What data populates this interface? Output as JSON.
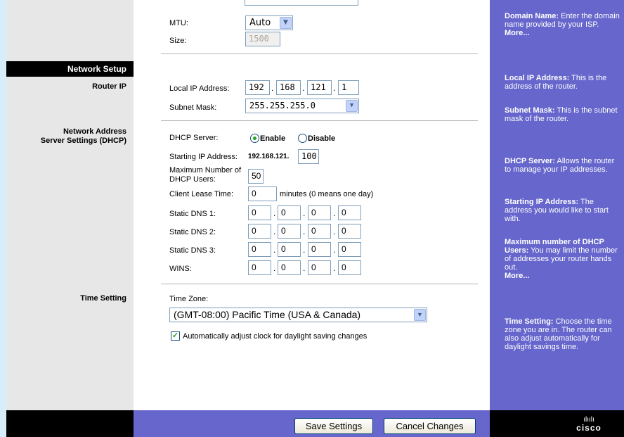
{
  "mtu": {
    "label": "MTU:",
    "value": "Auto",
    "size_label": "Size:",
    "size_value": "1500"
  },
  "sections": {
    "network_setup": "Network Setup",
    "router_ip": "Router IP",
    "dhcp_line1": "Network Address",
    "dhcp_line2": "Server Settings (DHCP)",
    "time_setting": "Time Setting"
  },
  "router_ip": {
    "local_ip_label": "Local IP Address:",
    "octets": [
      "192",
      "168",
      "121",
      "1"
    ],
    "subnet_label": "Subnet Mask:",
    "subnet_value": "255.255.255.0"
  },
  "dhcp": {
    "server_label": "DHCP Server:",
    "enable": "Enable",
    "disable": "Disable",
    "start_label": "Starting IP Address:",
    "start_prefix": "192.168.121.",
    "start_value": "100",
    "max_label_1": "Maximum Number of",
    "max_label_2": "DHCP Users:",
    "max_value": "50",
    "lease_label": "Client Lease Time:",
    "lease_value": "0",
    "lease_suffix": "minutes (0 means one day)",
    "dns1_label": "Static DNS 1:",
    "dns2_label": "Static DNS 2:",
    "dns3_label": "Static DNS 3:",
    "wins_label": "WINS:",
    "dns1": [
      "0",
      "0",
      "0",
      "0"
    ],
    "dns2": [
      "0",
      "0",
      "0",
      "0"
    ],
    "dns3": [
      "0",
      "0",
      "0",
      "0"
    ],
    "wins": [
      "0",
      "0",
      "0",
      "0"
    ]
  },
  "time": {
    "zone_label": "Time Zone:",
    "zone_value": "(GMT-08:00) Pacific Time (USA & Canada)",
    "dst_label": "Automatically adjust clock for daylight saving changes"
  },
  "buttons": {
    "save": "Save Settings",
    "cancel": "Cancel Changes"
  },
  "help": {
    "domain_title": "Domain Name:",
    "domain_text": " Enter the domain name provided by your ISP.",
    "more": "More...",
    "localip_title": "Local IP Address:",
    "localip_text": " This is the address of the router.",
    "subnet_title": "Subnet Mask:",
    "subnet_text": " This is the subnet mask of the router.",
    "dhcp_title": "DHCP Server:",
    "dhcp_text": " Allows the router to manage your IP addresses.",
    "start_title": "Starting IP Address:",
    "start_text": " The address you would like to start with.",
    "max_title": "Maximum number of DHCP Users:",
    "max_text": " You may limit the number of addresses your router hands out.",
    "time_title": "Time Setting:",
    "time_text": " Choose the time zone you are in. The router can also adjust automatically for daylight savings time."
  },
  "brand": {
    "logo_bars": "ılıılı",
    "logo_word": "cisco"
  },
  "colors": {
    "help_bg": "#6666cc",
    "left_bg": "#e7e7e7",
    "outer_bg": "#d6eef9"
  }
}
